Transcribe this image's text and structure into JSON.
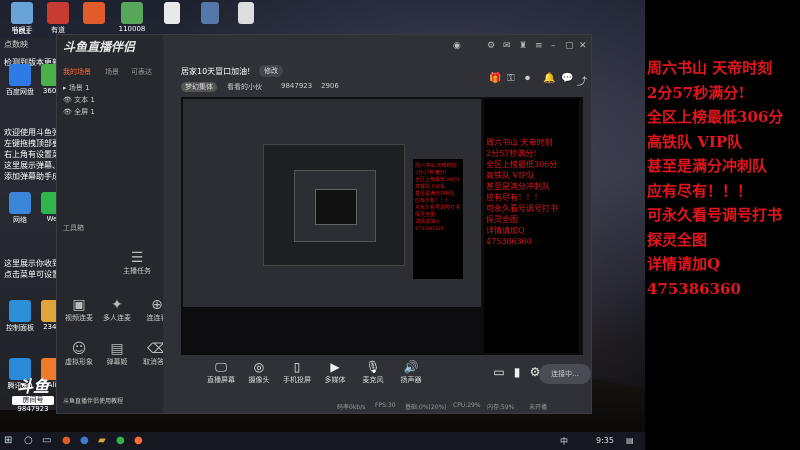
{
  "desktop": {
    "icons": [
      {
        "name": "desktop-icon-a",
        "label": "哔哩手",
        "color": "#6aa3d8"
      },
      {
        "name": "desktop-icon-b",
        "label": "DELL",
        "color": "#3e7bd1"
      },
      {
        "name": "desktop-icon-c",
        "label": "有道",
        "color": "#c73b33"
      },
      {
        "name": "desktop-icon-d",
        "label": "",
        "color": "#e25b2a"
      },
      {
        "name": "desktop-icon-e",
        "label": "110008",
        "color": "#58a55c"
      },
      {
        "name": "desktop-icon-f",
        "label": "",
        "color": "#3aa55c"
      },
      {
        "name": "desktop-icon-g",
        "label": "",
        "color": "#5577aa"
      },
      {
        "name": "desktop-icon-h",
        "label": "",
        "color": "#dddddd"
      },
      {
        "name": "desktop-icon-baidu",
        "label": "百度网盘",
        "color": "#2f7be5"
      },
      {
        "name": "desktop-icon-360",
        "label": "360B",
        "color": "#4ab04a"
      },
      {
        "name": "desktop-icon-network",
        "label": "网络",
        "color": "#3b86d9"
      },
      {
        "name": "desktop-icon-wechat",
        "label": "We",
        "color": "#2fb54b"
      },
      {
        "name": "desktop-icon-control",
        "label": "控制面板",
        "color": "#2d8fd8"
      },
      {
        "name": "desktop-icon-2345",
        "label": "2345",
        "color": "#e0a53b"
      },
      {
        "name": "desktop-icon-qq",
        "label": "腾讯QQ",
        "color": "#2a8ad8"
      },
      {
        "name": "desktop-icon-ali",
        "label": "Ali",
        "color": "#f07a2a"
      }
    ]
  },
  "left_panel": {
    "header": "点数映",
    "lines": [
      "检测到版本更新消息",
      "欢迎使用斗鱼弹幕助手",
      "左键拖拽顶部要位置，左键拉伸边框改变大小",
      "右上角有设置菜单",
      "这里展示弹幕、贵族续费、粉丝牌升级等",
      "添加弹幕助手成功",
      "这里展示你收到的礼物、道具、贵族开通",
      "点击菜单可设置小礼物屏蔽"
    ],
    "tool_group_label": "工具箱",
    "tools": [
      "主播任务",
      "视频连麦",
      "多人连麦",
      "连连看",
      "虚拟形象",
      "弹幕姬",
      "取消答手"
    ],
    "bottom_link": "斗鱼直播伴侣使用教程"
  },
  "app": {
    "logo": "斗鱼直播伴侣",
    "side_tabs": [
      "我的场景",
      "场景",
      "可表达"
    ],
    "scenes": [
      "场景 1",
      "文本 1",
      "全屏 1"
    ],
    "room_title": "居家10天冒口加油!",
    "edit_label": "修改",
    "game_badge": "梦幻集体",
    "category": "看看的小伙",
    "viewers_a": "9847923",
    "viewers_b": "2906",
    "bottom_tools": [
      "直播屏幕",
      "摄像头",
      "手机投屏",
      "多媒体",
      "麦克风",
      "扬声器"
    ],
    "live_button": "连接中...",
    "status": {
      "bitrate": "码率0kb/s",
      "fps": "FPS:30",
      "cpu_a": "基础:0%(20%)",
      "cpu": "CPU:29%",
      "mem": "内存:59%",
      "state": "未开播"
    }
  },
  "ad": {
    "lines": [
      "周六书山 天帝时刻",
      "2分57秒满分!",
      "全区上榜最低306分",
      "高铁队 VIP队",
      "甚至是满分冲刺队",
      "应有尽有！！！",
      "可永久看号调号打书",
      "探灵全图",
      "详情请加Q",
      "475386360"
    ],
    "color": "#e4161c"
  },
  "watermark": {
    "logo": "斗鱼",
    "sub": "房间号",
    "room": "9847923"
  },
  "taskbar": {
    "time": "9:35",
    "lang": "中"
  }
}
